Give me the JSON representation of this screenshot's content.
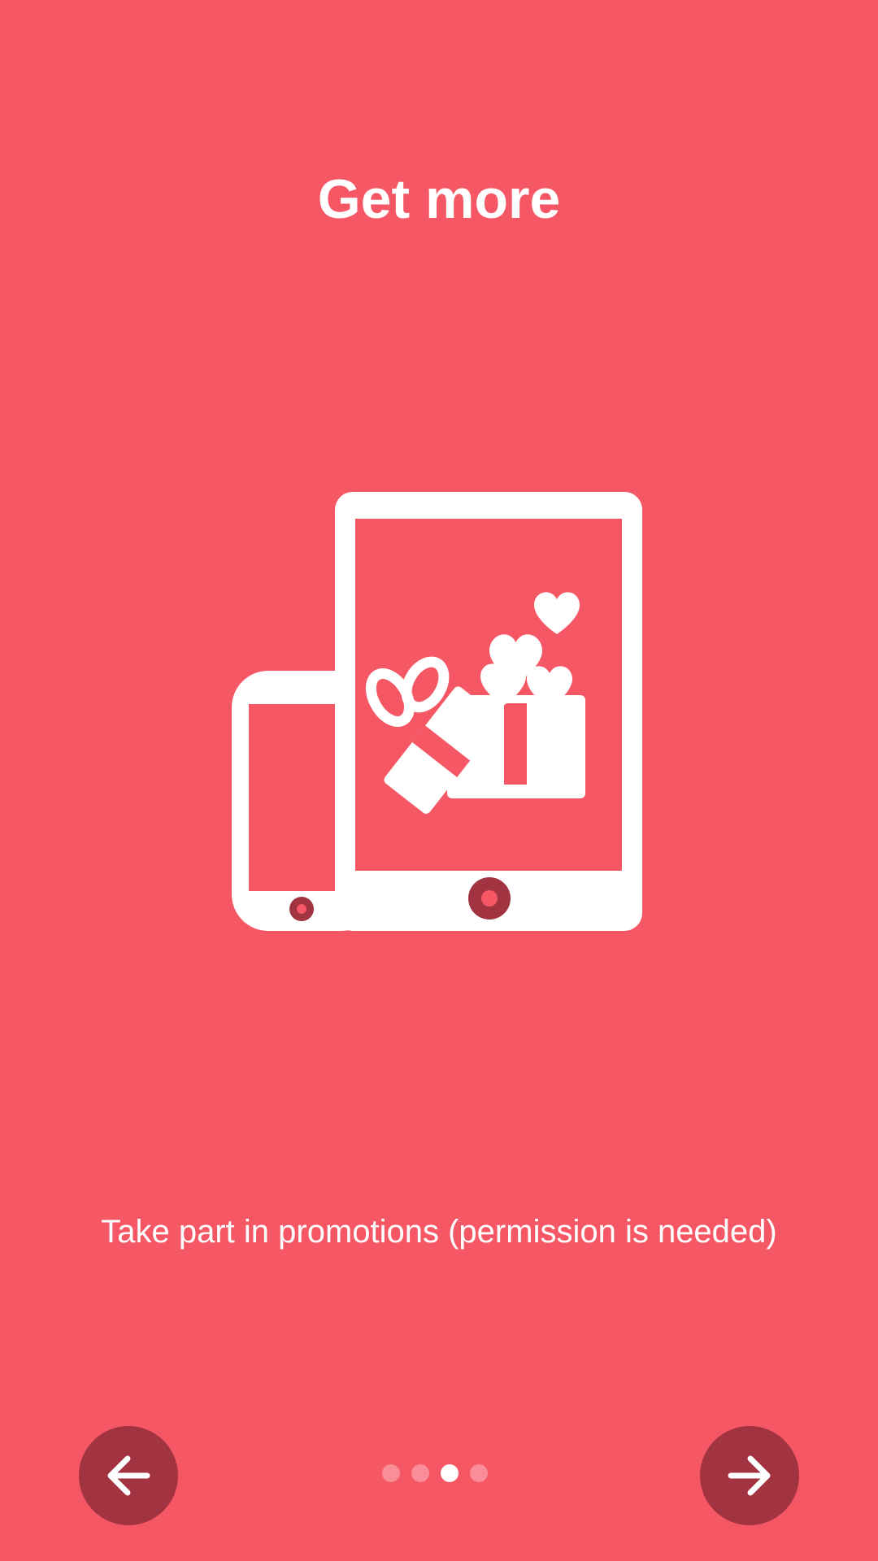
{
  "app": {
    "background_color": "#f55765",
    "accent_color": "#a23441"
  },
  "onboarding": {
    "title": "Get more",
    "description": "Take part in promotions (permission is needed)",
    "illustration_icon": "devices-gift-hearts-icon",
    "page_count": 4,
    "current_page": 3
  },
  "navigation": {
    "prev_icon": "arrow-left-icon",
    "next_icon": "arrow-right-icon"
  }
}
